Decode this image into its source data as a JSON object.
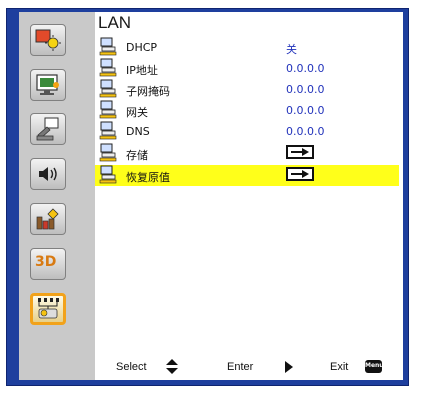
{
  "menu": {
    "title": "LAN",
    "rows": [
      {
        "label": "DHCP",
        "value": "关",
        "icon": "network-computer-icon"
      },
      {
        "label": "IP地址",
        "value": "0.0.0.0",
        "icon": "network-computer-icon"
      },
      {
        "label": "子网掩码",
        "value": "0.0.0.0",
        "icon": "network-computer-icon"
      },
      {
        "label": "网关",
        "value": "0.0.0.0",
        "icon": "network-computer-icon"
      },
      {
        "label": "DNS",
        "value": "0.0.0.0",
        "icon": "network-computer-icon"
      },
      {
        "label": "存储",
        "value": "",
        "icon": "network-computer-icon",
        "control": "enter-arrow-icon"
      },
      {
        "label": "恢复原值",
        "value": "",
        "icon": "network-computer-icon",
        "control": "enter-arrow-icon",
        "selected": true
      }
    ]
  },
  "sidebar": {
    "items": [
      {
        "icon": "image-sun-icon"
      },
      {
        "icon": "display-screen-icon"
      },
      {
        "icon": "projector-settings-icon"
      },
      {
        "icon": "volume-icon"
      },
      {
        "icon": "options-icon"
      },
      {
        "icon": "3d-icon",
        "text": "3D"
      },
      {
        "icon": "lan-network-icon",
        "active": true
      }
    ]
  },
  "footer": {
    "select_label": "Select",
    "enter_label": "Enter",
    "exit_label": "Exit",
    "menu_key_label": "Menu"
  },
  "colors": {
    "frame": "#1e3f9e",
    "highlight": "#ffff1a",
    "value_text": "#2233bb",
    "active_border": "#f2a21a"
  }
}
